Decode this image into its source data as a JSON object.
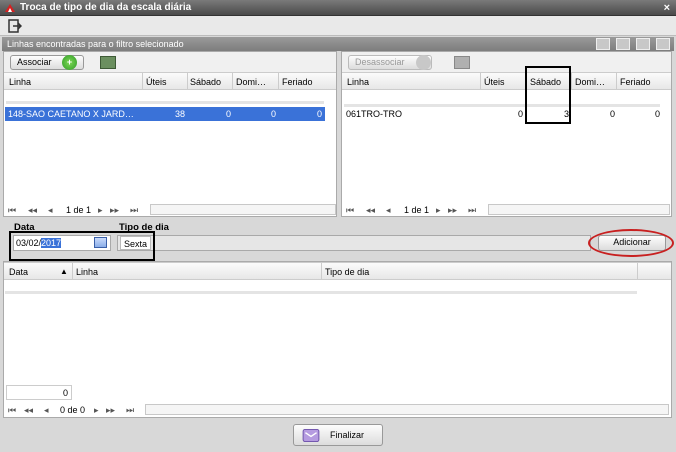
{
  "window": {
    "title": "Troca de tipo de dia da escala diária",
    "close_glyph": "×"
  },
  "section": {
    "title": "Linhas encontradas para o filtro selecionado"
  },
  "left_pane": {
    "add_button": "Associar",
    "columns": [
      "Linha",
      "Úteis",
      "Sábado",
      "Domi…",
      "Feriado"
    ],
    "row": [
      "148-SAO CAETANO X JARD…",
      "38",
      "0",
      "0",
      "0"
    ],
    "pager": {
      "page": "1 de 1"
    }
  },
  "right_pane": {
    "remove_button": "Desassociar",
    "columns": [
      "Linha",
      "Úteis",
      "Sábado",
      "Domi…",
      "Feriado"
    ],
    "row": [
      "061TRO-TRO",
      "0",
      "3",
      "0",
      "0"
    ],
    "pager": {
      "page": "1 de 1"
    }
  },
  "form": {
    "date_label": "Data",
    "date_value_prefix": "03/02/",
    "date_value_selected": "2017",
    "daytype_label": "Tipo de dia",
    "daytype_value": "Sexta",
    "add_button": "Adicionar"
  },
  "bottom_grid": {
    "columns": [
      "Data",
      "Linha",
      "Tipo de dia"
    ],
    "total": "0",
    "pager": {
      "page": "0 de 0"
    }
  },
  "footer": {
    "finish_button": "Finalizar"
  },
  "colors": {
    "selection": "#3a72d8",
    "highlight_red": "#c82020"
  }
}
